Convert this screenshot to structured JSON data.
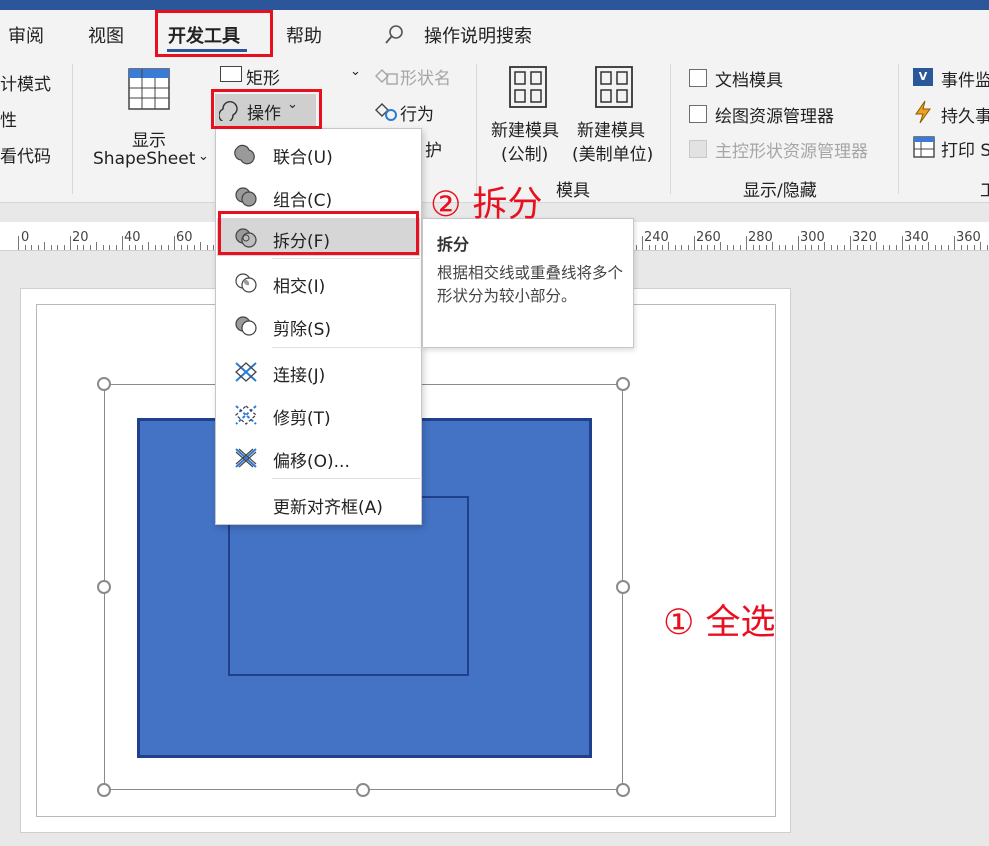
{
  "tabs": {
    "review": "审阅",
    "view": "视图",
    "developer": "开发工具",
    "help": "帮助",
    "search": "操作说明搜索"
  },
  "ribbon": {
    "code": {
      "design_mode": "计模式",
      "properties": "性",
      "view_code": "看代码"
    },
    "shape_design": {
      "show": "显示",
      "shapesheet": "ShapeSheet",
      "rectangle": "矩形",
      "operations": "操作",
      "shape_name": "形状名",
      "behavior": "行为",
      "protect": "护"
    },
    "stencil": {
      "new_metric_line1": "新建模具",
      "new_metric_line2": "(公制)",
      "new_us_line1": "新建模具",
      "new_us_line2": "(美制单位)",
      "group_label": "模具"
    },
    "show_hide": {
      "document_stencil": "文档模具",
      "drawing_explorer": "绘图资源管理器",
      "master_explorer": "主控形状资源管理器",
      "group_label": "显示/隐藏"
    },
    "right": {
      "event_monitor": "事件监",
      "persistent_events": "持久事",
      "print": "打印 S",
      "group_label": "工"
    }
  },
  "menu": {
    "items": [
      {
        "label": "联合(U)"
      },
      {
        "label": "组合(C)"
      },
      {
        "label": "拆分(F)"
      },
      {
        "label": "相交(I)"
      },
      {
        "label": "剪除(S)"
      },
      {
        "label": "连接(J)"
      },
      {
        "label": "修剪(T)"
      },
      {
        "label": "偏移(O)..."
      },
      {
        "label": "更新对齐框(A)"
      }
    ]
  },
  "tooltip": {
    "title": "拆分",
    "body": "根据相交线或重叠线将多个形状分为较小部分。"
  },
  "ruler": {
    "labels": [
      "0",
      "20",
      "40",
      "60",
      "240",
      "260",
      "280",
      "300",
      "320",
      "340",
      "360"
    ]
  },
  "annotations": {
    "step1": "① 全选",
    "step2": "② 拆分"
  },
  "colors": {
    "shape_fill": "#4472c4",
    "shape_border": "#203f8c",
    "highlight": "#e8101f",
    "title_bar": "#2b579a"
  }
}
